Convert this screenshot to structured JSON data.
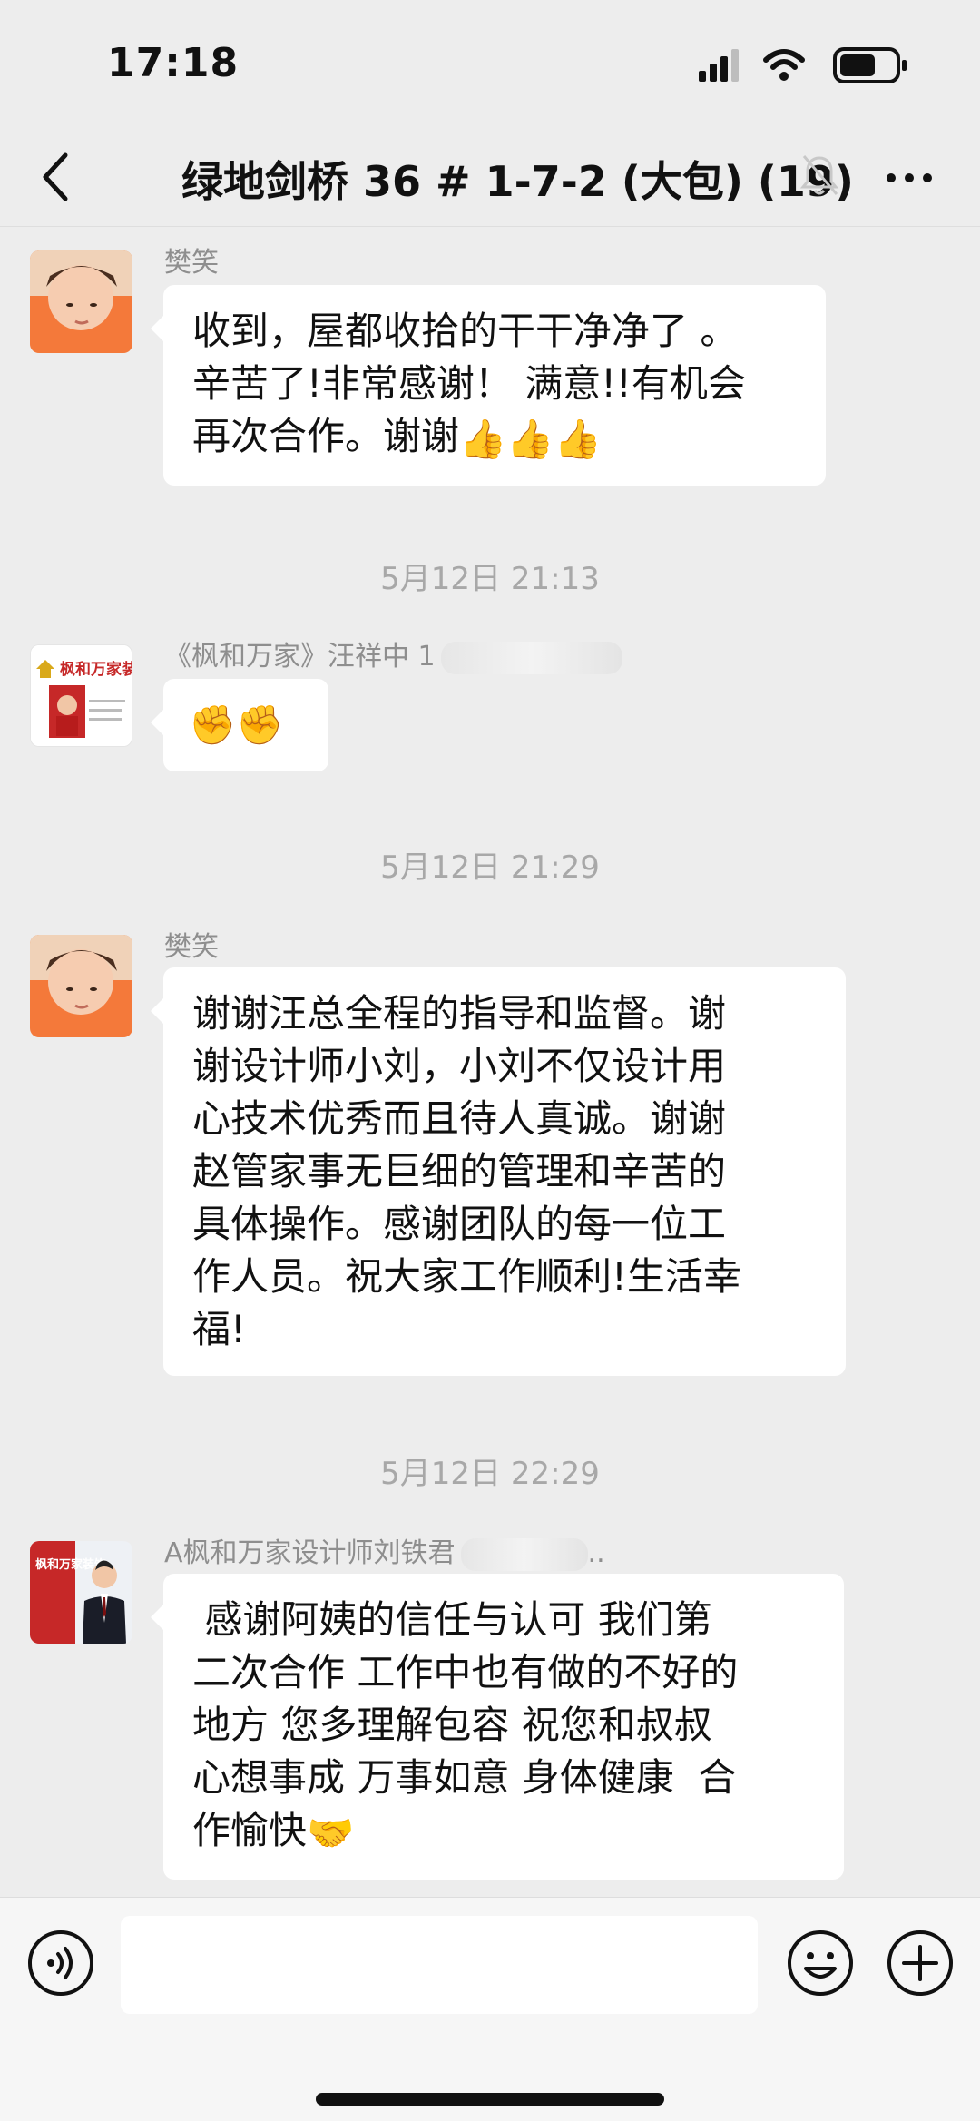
{
  "status_bar": {
    "time": "17:18"
  },
  "header": {
    "title": "绿地剑桥 36 # 1-7-2 (大包) (19)"
  },
  "messages": [
    {
      "sender": "樊笑",
      "lines": [
        "收到，屋都收拾的干干净净了 。",
        "辛苦了!非常感谢！ 满意!!有机会",
        "再次合作。谢谢"
      ],
      "emoji": "👍👍👍"
    },
    {
      "sender": "《枫和万家》汪祥中 1",
      "emoji": "✊✊",
      "avatar_text": "枫和万家装饰"
    },
    {
      "sender": "樊笑",
      "lines": [
        "谢谢汪总全程的指导和监督。谢",
        "谢设计师小刘，小刘不仅设计用",
        "心技术优秀而且待人真诚。谢谢",
        "赵管家事无巨细的管理和辛苦的",
        "具体操作。感谢团队的每一位工",
        "作人员。祝大家工作顺利!生活幸",
        "福!"
      ]
    },
    {
      "sender": "A枫和万家设计师刘铁君",
      "sender_suffix": "..",
      "lines": [
        " 感谢阿姨的信任与认可 我们第",
        "二次合作 工作中也有做的不好的",
        "地方 您多理解包容 祝您和叔叔",
        "心想事成 万事如意 身体健康  合",
        "作愉快"
      ],
      "emoji": "🤝",
      "avatar_text": "枫和万家装饰"
    }
  ],
  "timestamps": [
    "5月12日 21:13",
    "5月12日 21:29",
    "5月12日 22:29"
  ],
  "input": {
    "value": "",
    "placeholder": ""
  },
  "icons": {
    "back": "back-chevron-icon",
    "mute": "mute-bell-icon",
    "more": "more-dots-icon",
    "voice": "voice-icon",
    "emoji": "smile-icon",
    "plus": "plus-icon"
  },
  "colors": {
    "background": "#ededed",
    "bubble": "#ffffff",
    "muted_text": "#8e8e8e",
    "accent_red": "#c62828"
  }
}
